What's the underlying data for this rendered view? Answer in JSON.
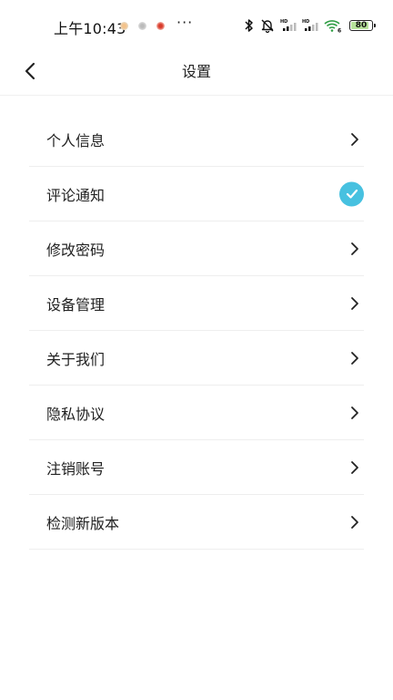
{
  "status_bar": {
    "time": "上午10:43",
    "more": "···",
    "battery": "80",
    "icons": [
      "bluetooth-icon",
      "bell-off-icon",
      "signal-hd-icon",
      "signal-hd-icon",
      "wifi-icon",
      "battery-icon"
    ],
    "app_icons": [
      "notification-app-icon",
      "notification-app-icon",
      "notification-app-icon"
    ]
  },
  "header": {
    "title": "设置",
    "back_icon": "chevron-left-icon"
  },
  "settings": {
    "items": [
      {
        "label": "个人信息",
        "accessory": "chevron-right-icon"
      },
      {
        "label": "评论通知",
        "accessory": "check-circle-icon"
      },
      {
        "label": "修改密码",
        "accessory": "chevron-right-icon"
      },
      {
        "label": "设备管理",
        "accessory": "chevron-right-icon"
      },
      {
        "label": "关于我们",
        "accessory": "chevron-right-icon"
      },
      {
        "label": "隐私协议",
        "accessory": "chevron-right-icon"
      },
      {
        "label": "注销账号",
        "accessory": "chevron-right-icon"
      },
      {
        "label": "检测新版本",
        "accessory": "chevron-right-icon"
      }
    ]
  },
  "colors": {
    "accent": "#47c1e0",
    "divider": "#eeeeee",
    "text": "#222222",
    "background": "#ffffff"
  }
}
